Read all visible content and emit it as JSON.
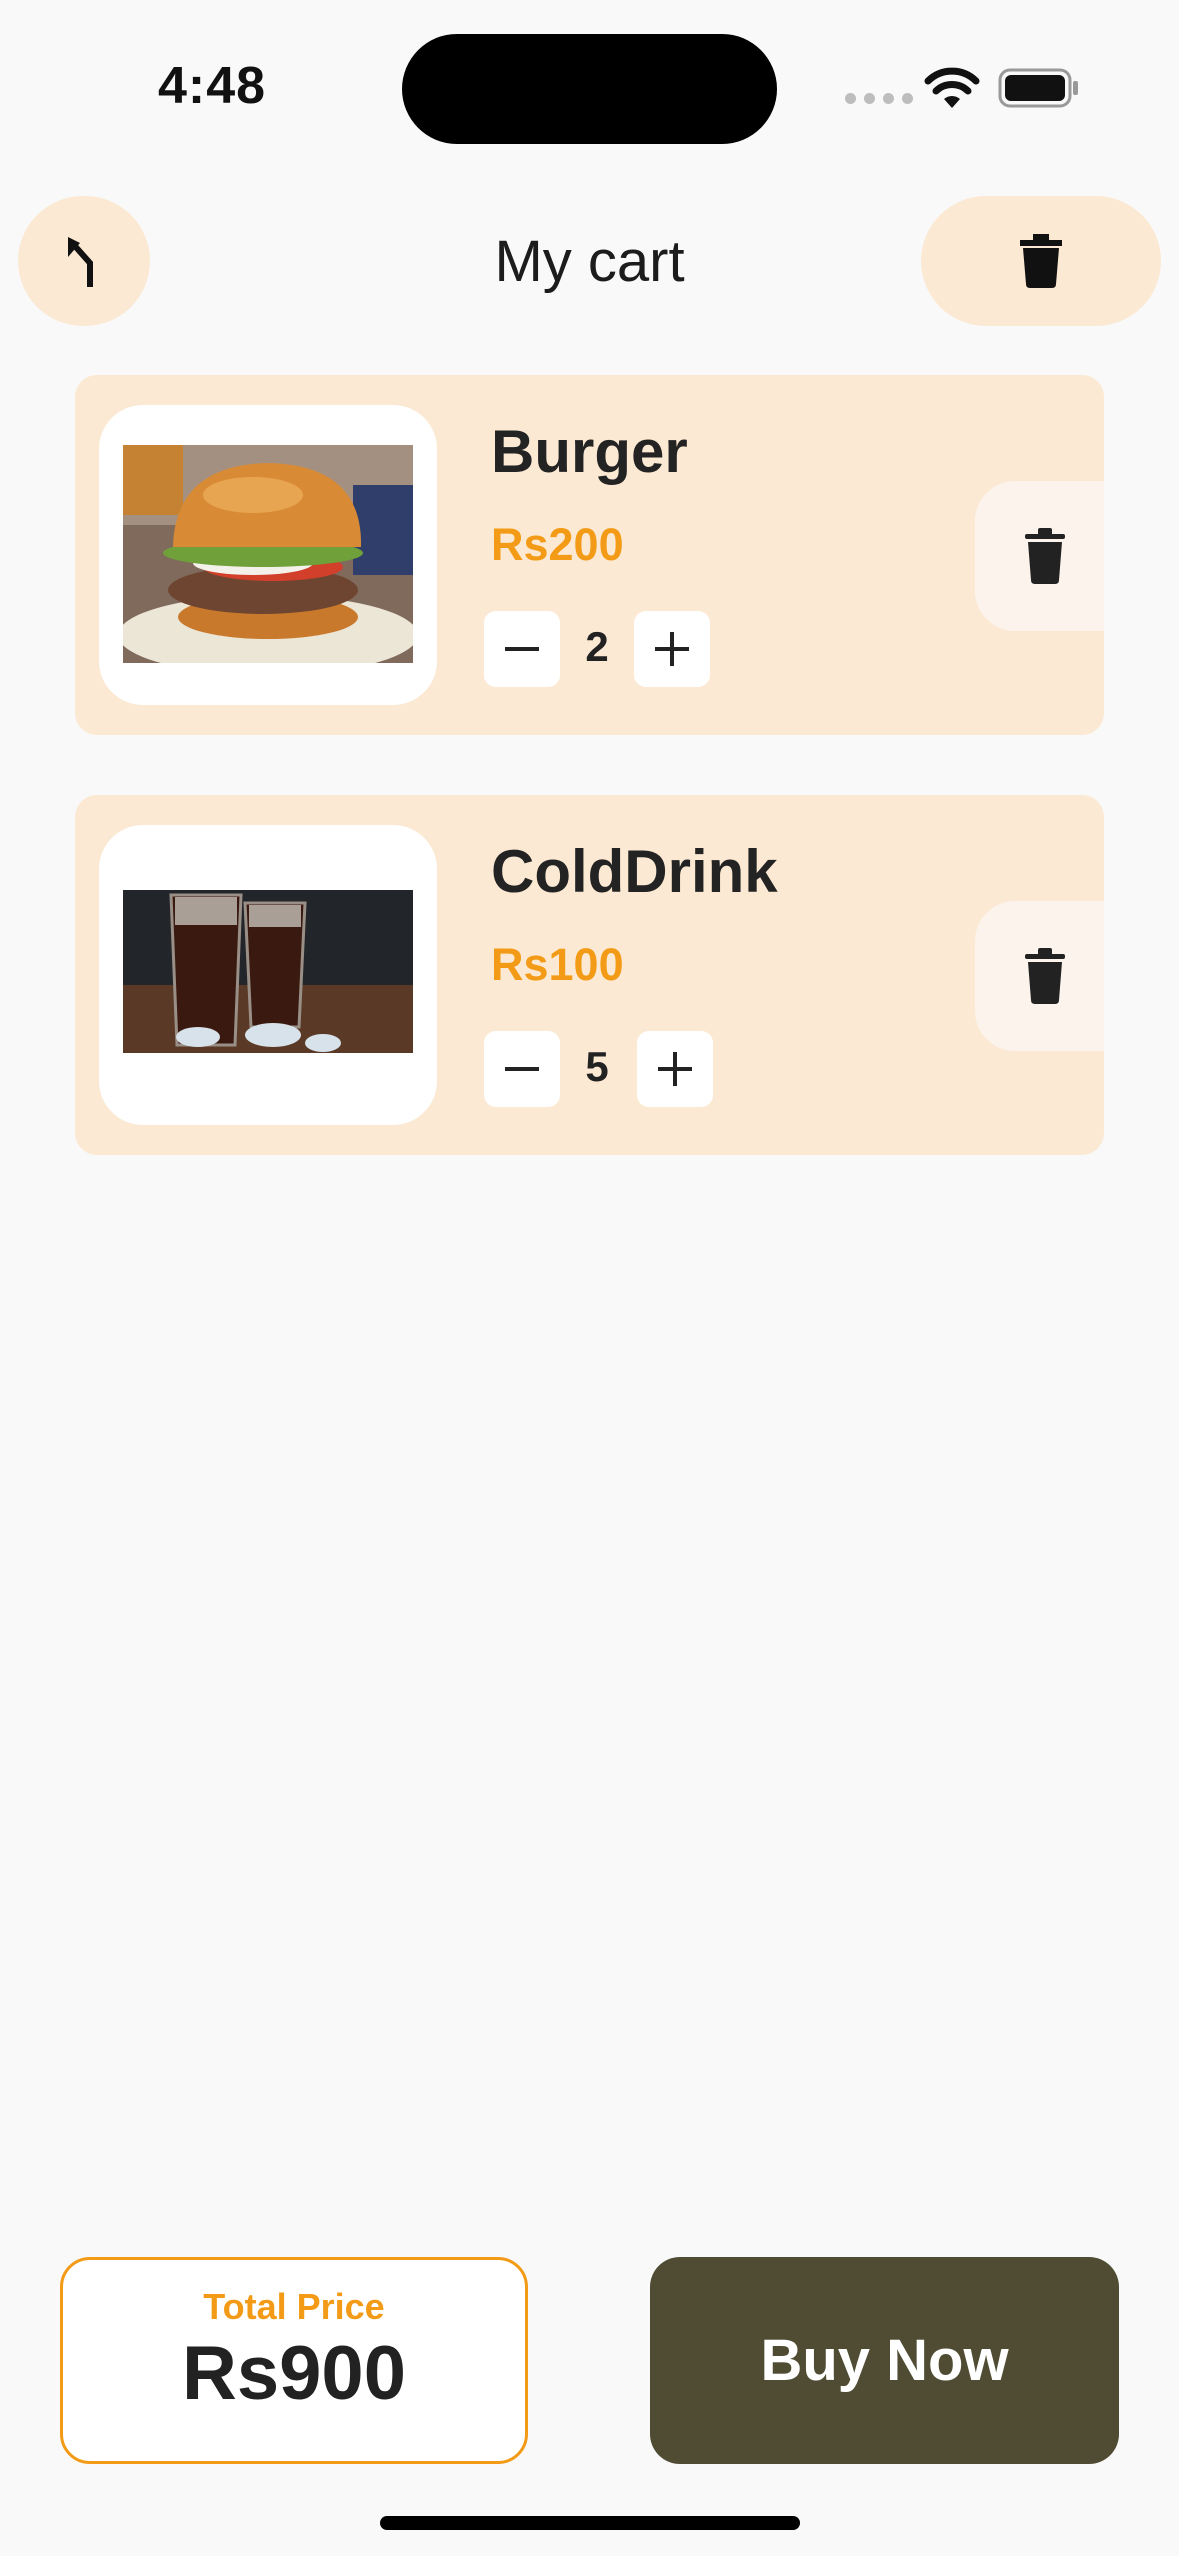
{
  "status_bar": {
    "time": "4:48"
  },
  "header": {
    "title": "My cart",
    "back_icon": "return-arrow-icon",
    "clear_icon": "trash-icon"
  },
  "cart": {
    "items": [
      {
        "name": "Burger",
        "price": "Rs200",
        "quantity": "2",
        "image": "burger-photo"
      },
      {
        "name": "ColdDrink",
        "price": "Rs100",
        "quantity": "5",
        "image": "cold-drink-photo"
      }
    ]
  },
  "footer": {
    "total_label": "Total Price",
    "total_value": "Rs900",
    "buy_label": "Buy Now"
  },
  "colors": {
    "accent": "#f39b16",
    "card_bg": "#fbe9d3",
    "buy_button": "#4f4c33"
  }
}
